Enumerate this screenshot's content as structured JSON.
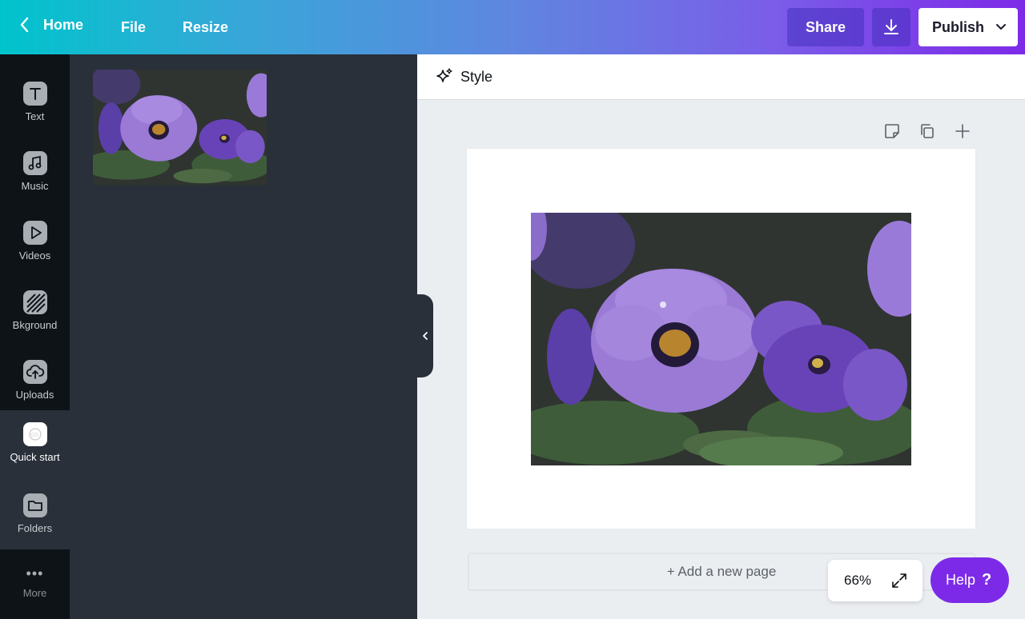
{
  "topbar": {
    "home_label": "Home",
    "file_label": "File",
    "resize_label": "Resize",
    "share_label": "Share",
    "publish_label": "Publish"
  },
  "sidebar": {
    "items": [
      {
        "label": "Text",
        "icon": "text-icon"
      },
      {
        "label": "Music",
        "icon": "music-icon"
      },
      {
        "label": "Videos",
        "icon": "videos-icon"
      },
      {
        "label": "Bkground",
        "icon": "background-icon"
      },
      {
        "label": "Uploads",
        "icon": "uploads-icon"
      },
      {
        "label": "Quick start",
        "icon": "quick-start-icon"
      },
      {
        "label": "Folders",
        "icon": "folder-icon"
      },
      {
        "label": "More",
        "icon": "more-icon"
      }
    ],
    "active_item": "Quick start"
  },
  "toolbar": {
    "style_label": "Style"
  },
  "canvas": {
    "add_page_label": "+ Add a new page",
    "zoom": "66%"
  },
  "help": {
    "label": "Help",
    "glyph": "?"
  },
  "colors": {
    "brand_teal": "#00c4cc",
    "brand_purple": "#7d2ae8",
    "panel_bg": "#293039",
    "rail_bg": "#0e1318"
  }
}
